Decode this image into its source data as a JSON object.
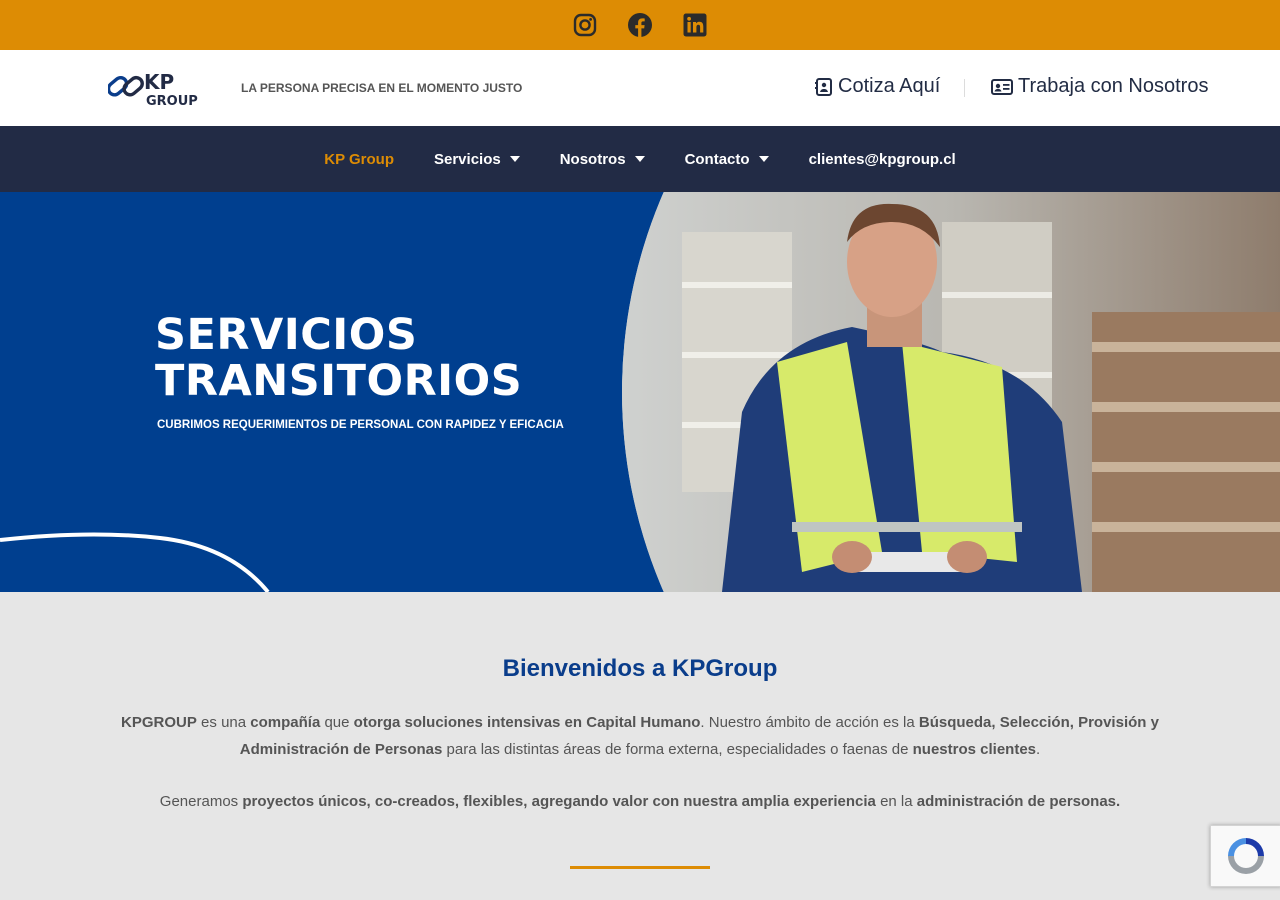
{
  "social": {
    "icons": [
      "instagram-icon",
      "facebook-icon",
      "linkedin-icon"
    ],
    "bar_color": "#dd8c04"
  },
  "header": {
    "logo_text_top": "KP",
    "logo_text_bottom": "GROUP",
    "tagline": "LA PERSONA PRECISA EN EL MOMENTO JUSTO",
    "cotiza_label": "Cotiza Aquí",
    "trabaja_label": "Trabaja con Nosotros"
  },
  "nav": {
    "items": [
      {
        "label": "KP Group",
        "active": true
      },
      {
        "label": "Servicios",
        "dropdown": true
      },
      {
        "label": "Nosotros",
        "dropdown": true
      },
      {
        "label": "Contacto",
        "dropdown": true
      },
      {
        "label": "clientes@kpgroup.cl"
      }
    ],
    "background": "#222b45",
    "active_color": "#dd8c04"
  },
  "hero": {
    "title_line1": "SERVICIOS",
    "title_line2": "TRANSITORIOS",
    "subtitle": "CUBRIMOS REQUERIMIENTOS DE PERSONAL CON RAPIDEZ Y EFICACIA",
    "background": "#003f8f"
  },
  "welcome": {
    "heading": "Bienvenidos a KPGroup",
    "p1": [
      {
        "t": "KPGROUP",
        "b": true
      },
      {
        "t": " es una ",
        "b": false
      },
      {
        "t": "compañía",
        "b": true
      },
      {
        "t": " que ",
        "b": false
      },
      {
        "t": "otorga soluciones intensivas en Capital Humano",
        "b": true
      },
      {
        "t": ". Nuestro ámbito de acción es la ",
        "b": false
      },
      {
        "t": "Búsqueda, Selección, Provisión y Administración de Personas",
        "b": true
      },
      {
        "t": " para las distintas áreas de forma externa, especialidades o faenas de ",
        "b": false
      },
      {
        "t": "nuestros clientes",
        "b": true
      },
      {
        "t": ".",
        "b": false
      }
    ],
    "p2": [
      {
        "t": "Generamos ",
        "b": false
      },
      {
        "t": "proyectos únicos, co-creados, flexibles, agregando valor con nuestra amplia experiencia",
        "b": true
      },
      {
        "t": " en la ",
        "b": false
      },
      {
        "t": "administración de personas.",
        "b": true
      }
    ]
  }
}
